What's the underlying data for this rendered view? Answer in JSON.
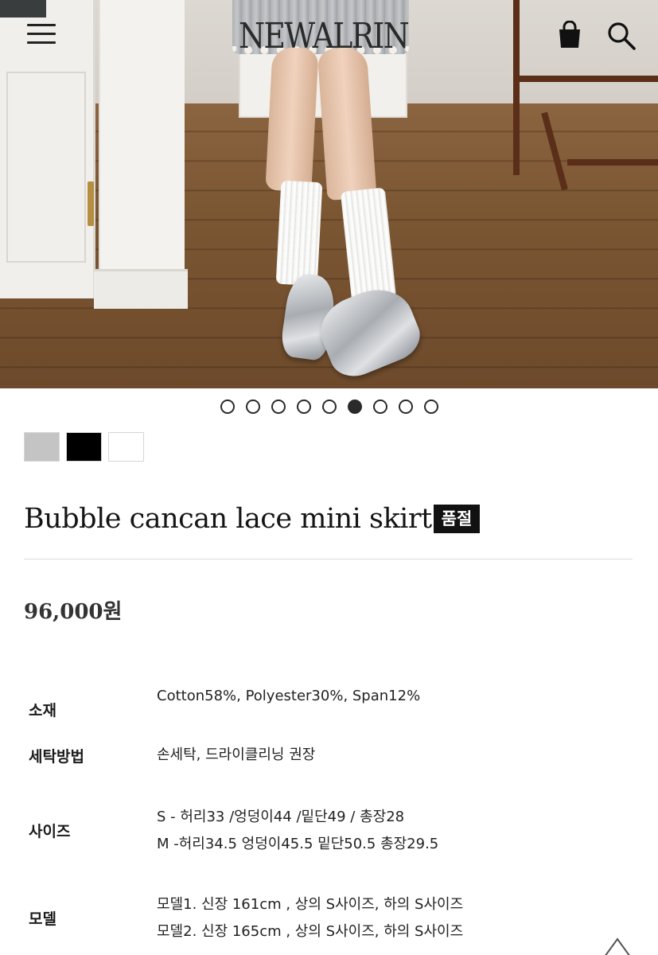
{
  "header": {
    "logo": "NEWALRIN",
    "menu_icon": "hamburger-menu-icon",
    "cart_icon": "shopping-bag-icon",
    "search_icon": "search-icon"
  },
  "gallery": {
    "total_images": 9,
    "active_index": 6
  },
  "swatches": [
    {
      "color": "#c4c4c4"
    },
    {
      "color": "#000000"
    },
    {
      "color": "#ffffff"
    }
  ],
  "product": {
    "title": "Bubble cancan lace mini skirt",
    "badge": "품절",
    "price": "96,000원"
  },
  "details": [
    {
      "label": "소재",
      "lines": [
        "Cotton58%, Polyester30%, Span12%"
      ]
    },
    {
      "label": "세탁방법",
      "lines": [
        "손세탁, 드라이클리닝 권장"
      ]
    },
    {
      "label": "사이즈",
      "lines": [
        "S - 허리33 /엉덩이44 /밑단49 / 총장28",
        "M -허리34.5 엉덩이45.5 밑단50.5 총장29.5"
      ]
    },
    {
      "label": "모델",
      "lines": [
        "모델1. 신장 161cm , 상의 S사이즈, 하의 S사이즈",
        "모델2. 신장 165cm , 상의 S사이즈, 하의 S사이즈"
      ]
    }
  ],
  "scroll_top_icon": "chevron-up-icon"
}
